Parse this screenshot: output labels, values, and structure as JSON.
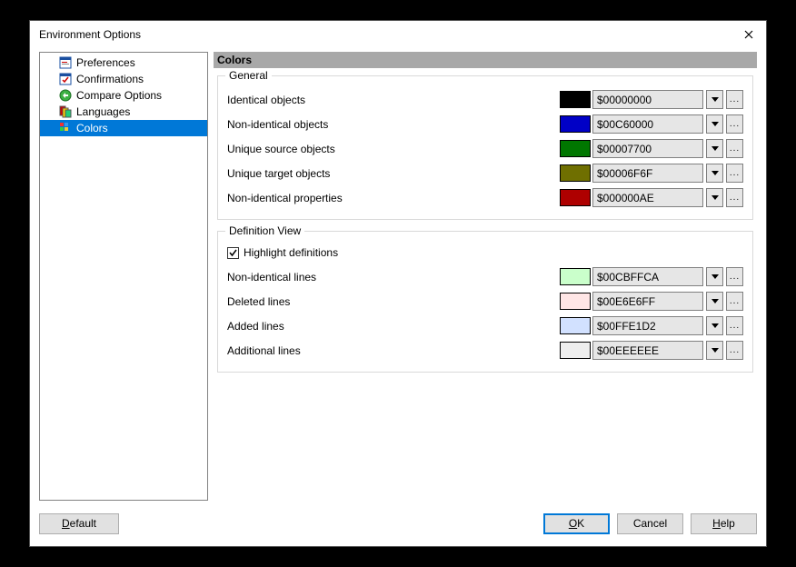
{
  "window": {
    "title": "Environment Options"
  },
  "sidebar": {
    "items": [
      {
        "label": "Preferences"
      },
      {
        "label": "Confirmations"
      },
      {
        "label": "Compare Options"
      },
      {
        "label": "Languages"
      },
      {
        "label": "Colors"
      }
    ],
    "selectedIndex": 4
  },
  "section": {
    "title": "Colors"
  },
  "groups": {
    "general": {
      "legend": "General",
      "rows": [
        {
          "label": "Identical objects",
          "color": "#000000",
          "value": "$00000000"
        },
        {
          "label": "Non-identical objects",
          "color": "#0000c6",
          "value": "$00C60000"
        },
        {
          "label": "Unique source objects",
          "color": "#007700",
          "value": "$00007700"
        },
        {
          "label": "Unique target objects",
          "color": "#6f6f00",
          "value": "$00006F6F"
        },
        {
          "label": "Non-identical properties",
          "color": "#ae0000",
          "value": "$000000AE"
        }
      ]
    },
    "defview": {
      "legend": "Definition View",
      "highlightLabel": "Highlight definitions",
      "highlightChecked": true,
      "rows": [
        {
          "label": "Non-identical lines",
          "color": "#caffcb",
          "value": "$00CBFFCA"
        },
        {
          "label": "Deleted lines",
          "color": "#ffe6e6",
          "value": "$00E6E6FF"
        },
        {
          "label": "Added lines",
          "color": "#d2e1ff",
          "value": "$00FFE1D2"
        },
        {
          "label": "Additional lines",
          "color": "#eeeeee",
          "value": "$00EEEEEE"
        }
      ]
    }
  },
  "buttons": {
    "default": "Default",
    "ok": "OK",
    "cancel": "Cancel",
    "help": "Help"
  }
}
